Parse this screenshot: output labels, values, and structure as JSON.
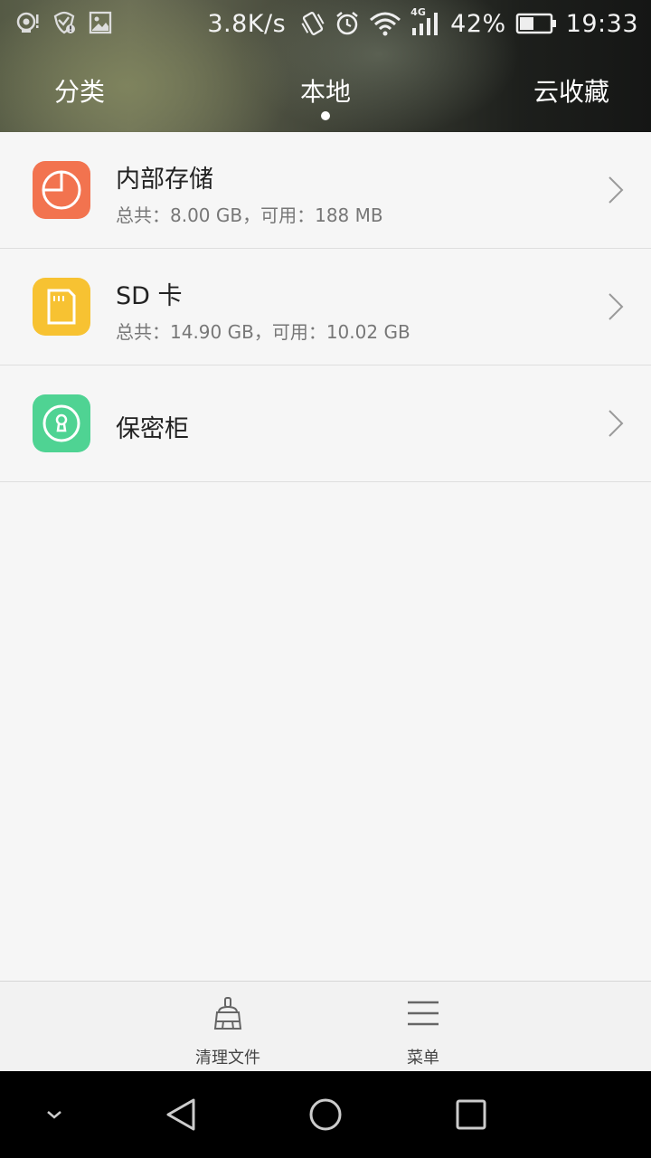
{
  "status_bar": {
    "net_speed": "3.8K/s",
    "network_type": "4G",
    "battery": "42%",
    "time": "19:33",
    "left_icons": [
      "notification-app-icon",
      "shield-alert-icon",
      "image-icon"
    ],
    "right_icons": [
      "vibrate-icon",
      "alarm-icon",
      "wifi-icon",
      "signal-icon",
      "battery-icon"
    ]
  },
  "tabs": [
    {
      "label": "分类",
      "active": false
    },
    {
      "label": "本地",
      "active": true
    },
    {
      "label": "云收藏",
      "active": false
    }
  ],
  "storage_items": [
    {
      "title": "内部存储",
      "subtitle": "总共：8.00 GB，可用：188 MB",
      "icon": "pie-chart-icon",
      "color": "#f2734f"
    },
    {
      "title": "SD 卡",
      "subtitle": "总共：14.90 GB，可用：10.02 GB",
      "icon": "sd-card-icon",
      "color": "#f7c232"
    },
    {
      "title": "保密柜",
      "subtitle": "",
      "icon": "lock-keyhole-icon",
      "color": "#4fd393"
    }
  ],
  "bottom_bar": {
    "clean_label": "清理文件",
    "menu_label": "菜单"
  },
  "nav_bar": {
    "icons": [
      "collapse-chevron-icon",
      "back-icon",
      "home-icon",
      "recents-icon"
    ]
  }
}
